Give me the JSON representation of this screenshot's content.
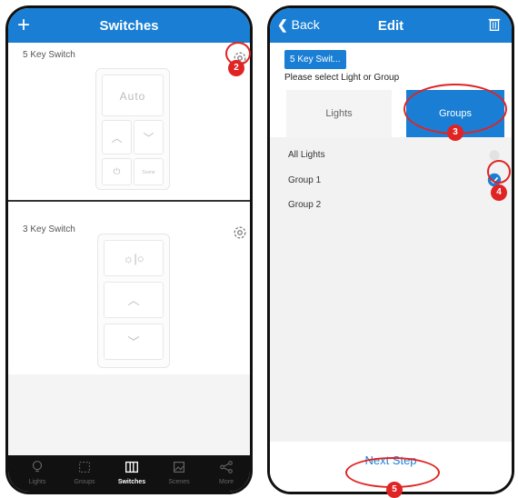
{
  "left": {
    "header": {
      "title": "Switches"
    },
    "cards": [
      {
        "label": "5 Key Switch",
        "auto_label": "Auto",
        "scene_label": "Scene"
      },
      {
        "label": "3 Key Switch"
      }
    ],
    "tabs": [
      {
        "label": "Lights"
      },
      {
        "label": "Groups"
      },
      {
        "label": "Switches"
      },
      {
        "label": "Scenes"
      },
      {
        "label": "More"
      }
    ]
  },
  "right": {
    "header": {
      "title": "Edit",
      "back_label": "Back"
    },
    "switch_chip": "5 Key Swit...",
    "prompt": "Please select Light or Group",
    "segments": {
      "lights": "Lights",
      "groups": "Groups"
    },
    "list": [
      {
        "label": "All Lights"
      },
      {
        "label": "Group 1"
      },
      {
        "label": "Group 2"
      }
    ],
    "next_step": "Next Step"
  },
  "markers": [
    "2",
    "3",
    "4",
    "5"
  ],
  "colors": {
    "accent": "#1a7fd4",
    "annotation": "#e02424"
  }
}
